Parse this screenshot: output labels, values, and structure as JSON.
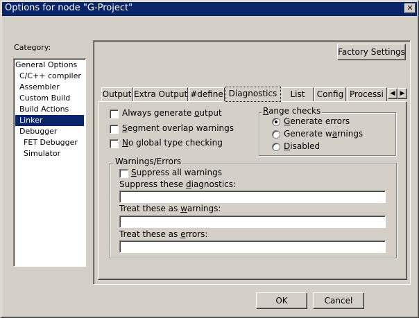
{
  "window": {
    "title": "Options for node \"G-Project\"",
    "close_glyph": "✕"
  },
  "category": {
    "label": "Category:",
    "items": [
      {
        "label": "General Options"
      },
      {
        "label": "C/C++ compiler"
      },
      {
        "label": "Assembler"
      },
      {
        "label": "Custom Build"
      },
      {
        "label": "Build Actions"
      },
      {
        "label": "Linker",
        "selected": true
      },
      {
        "label": "Debugger"
      },
      {
        "label": "FET Debugger"
      },
      {
        "label": "Simulator"
      }
    ]
  },
  "factory_settings_label": "Factory Settings",
  "tabs": [
    {
      "label": "Output"
    },
    {
      "label": "Extra Output"
    },
    {
      "label": "#define"
    },
    {
      "label": "Diagnostics",
      "active": true
    },
    {
      "label": "List"
    },
    {
      "label": "Config"
    },
    {
      "label": "Processi"
    }
  ],
  "tab_scroll": {
    "left": "◀",
    "right": "▶"
  },
  "diagnostics": {
    "checks": {
      "always_generate_output": {
        "pre": "Always generate ",
        "u": "o",
        "post": "utput",
        "checked": false
      },
      "segment_overlap": {
        "pre": "",
        "u": "S",
        "post": "egment overlap warnings",
        "checked": false
      },
      "no_global_type": {
        "pre": "",
        "u": "N",
        "post": "o global type checking",
        "checked": false
      }
    },
    "range_checks": {
      "label_u": "R",
      "label_post": "ange checks",
      "options": [
        {
          "pre": "",
          "u": "G",
          "post": "enerate errors",
          "selected": true
        },
        {
          "pre": "Generate w",
          "u": "a",
          "post": "rnings",
          "selected": false
        },
        {
          "pre": "",
          "u": "D",
          "post": "isabled",
          "selected": false
        }
      ]
    },
    "warnings_errors": {
      "label": "Warnings/Errors",
      "suppress_all": {
        "pre": "",
        "u": "S",
        "post": "uppress all warnings",
        "checked": false
      },
      "suppress_diag": {
        "pre": "Suppress these ",
        "u": "d",
        "post": "iagnostics:",
        "value": ""
      },
      "treat_warnings": {
        "pre": "Treat these as ",
        "u": "w",
        "post": "arnings:",
        "value": ""
      },
      "treat_errors": {
        "pre": "Treat these as ",
        "u": "e",
        "post": "rrors:",
        "value": ""
      }
    }
  },
  "buttons": {
    "ok": "OK",
    "cancel": "Cancel"
  }
}
